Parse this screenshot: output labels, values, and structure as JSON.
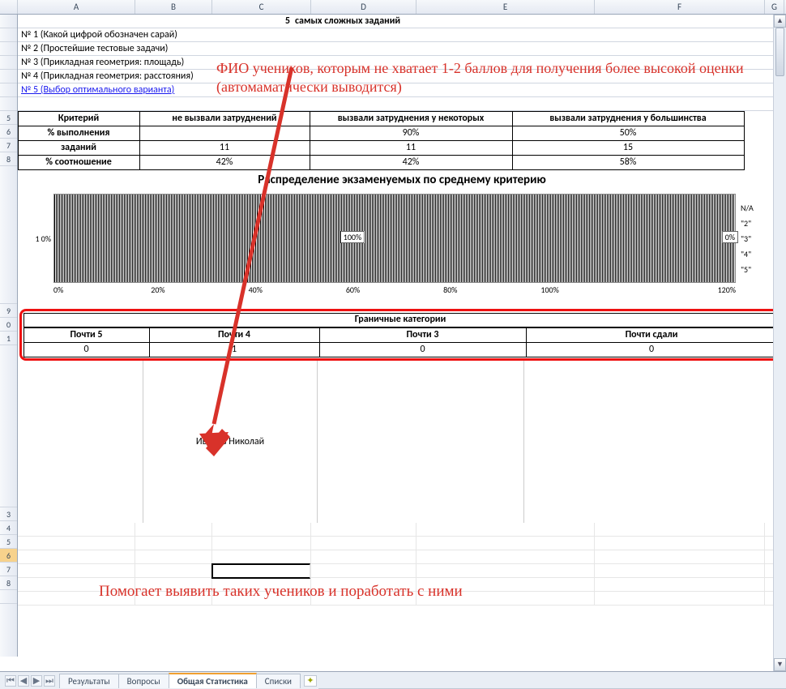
{
  "columns": [
    "A",
    "B",
    "C",
    "D",
    "E",
    "F",
    "G"
  ],
  "section_title_num": "5",
  "section_title_text": "самых сложных заданий",
  "hardest": [
    "№ 1 (Какой цифрой обозначен сарай)",
    "№ 2 (Простейшие тестовые задачи)",
    "№ 3 (Прикладная геометрия: площадь)",
    "№ 4 (Прикладная геометрия: расстояния)",
    "№ 5 (Выбор оптимального варианта)"
  ],
  "criteria": {
    "headers": [
      "Критерий",
      "не вызвали затруднений",
      "вызвали затруднения у некоторых",
      "вызвали затруднения у большинства"
    ],
    "rows": [
      {
        "label": "% выполнения",
        "vals": [
          "",
          "90%",
          "50%"
        ]
      },
      {
        "label": "заданий",
        "vals": [
          "11",
          "11",
          "15"
        ]
      },
      {
        "label": "% соотношение",
        "vals": [
          "42%",
          "42%",
          "58%"
        ]
      }
    ]
  },
  "chart_data": {
    "type": "bar",
    "title": "Распределение экзаменуемых по среднему критерию",
    "orientation": "horizontal-stacked",
    "y_label": "1",
    "categories": [
      "1"
    ],
    "series": [
      {
        "name": "N/A",
        "value": 0
      },
      {
        "name": "\"2\"",
        "value": 0
      },
      {
        "name": "\"3\"",
        "value": 100
      },
      {
        "name": "\"4\"",
        "value": 0
      },
      {
        "name": "\"5\"",
        "value": 0
      }
    ],
    "data_labels": [
      "0%",
      "100%",
      "0%"
    ],
    "xticks": [
      "0%",
      "20%",
      "40%",
      "60%",
      "80%",
      "100%",
      "120%"
    ],
    "xlabel": "",
    "ylabel": "",
    "xlim": [
      0,
      120
    ]
  },
  "boundary": {
    "title": "Граничные категории",
    "cols": [
      "Почти 5",
      "Почти 4",
      "Почти 3",
      "Почти сдали"
    ],
    "vals": [
      "0",
      "1",
      "0",
      "0"
    ],
    "names": [
      "",
      "Иванов Николай",
      "",
      ""
    ]
  },
  "annotations": {
    "a1": "ФИО учеников, которым не хватает 1-2 баллов для получения более высокой оценки (автомаматически выводится)",
    "a2": "Помогает выявить таких учеников и поработать с ними"
  },
  "tabs": {
    "items": [
      "Результаты",
      "Вопросы",
      "Общая Статистика",
      "Списки"
    ],
    "active": 2
  },
  "selected_cell": {
    "col": "C",
    "row": "blank"
  },
  "row_numbers_visible": [
    "",
    "",
    "",
    "",
    "",
    "",
    "",
    "",
    "",
    "",
    "",
    "",
    "",
    "",
    "",
    "",
    "",
    "",
    ""
  ]
}
